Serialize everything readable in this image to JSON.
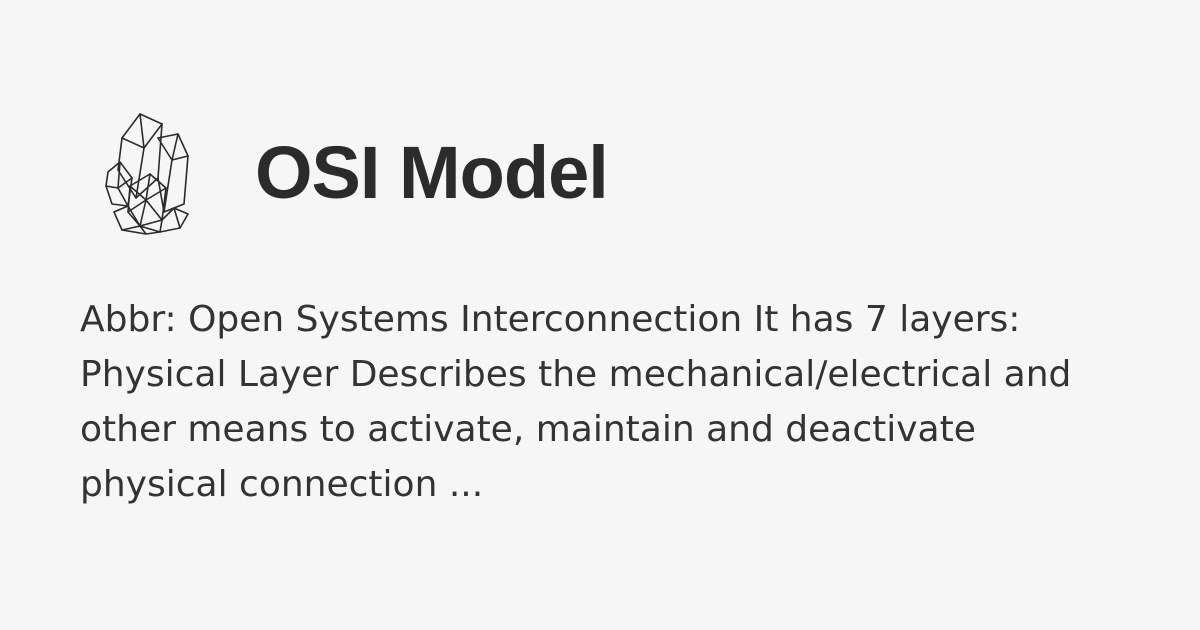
{
  "header": {
    "logo_icon": "crystal-cluster-icon",
    "title": "OSI Model"
  },
  "body": {
    "description": "Abbr: Open Systems Interconnection It has 7 layers: Physical Layer Describes the mechanical/electrical and other means to activate, maintain and deactivate physical connection ..."
  },
  "colors": {
    "background": "#f7f6f7",
    "text": "#2b2b2b"
  }
}
